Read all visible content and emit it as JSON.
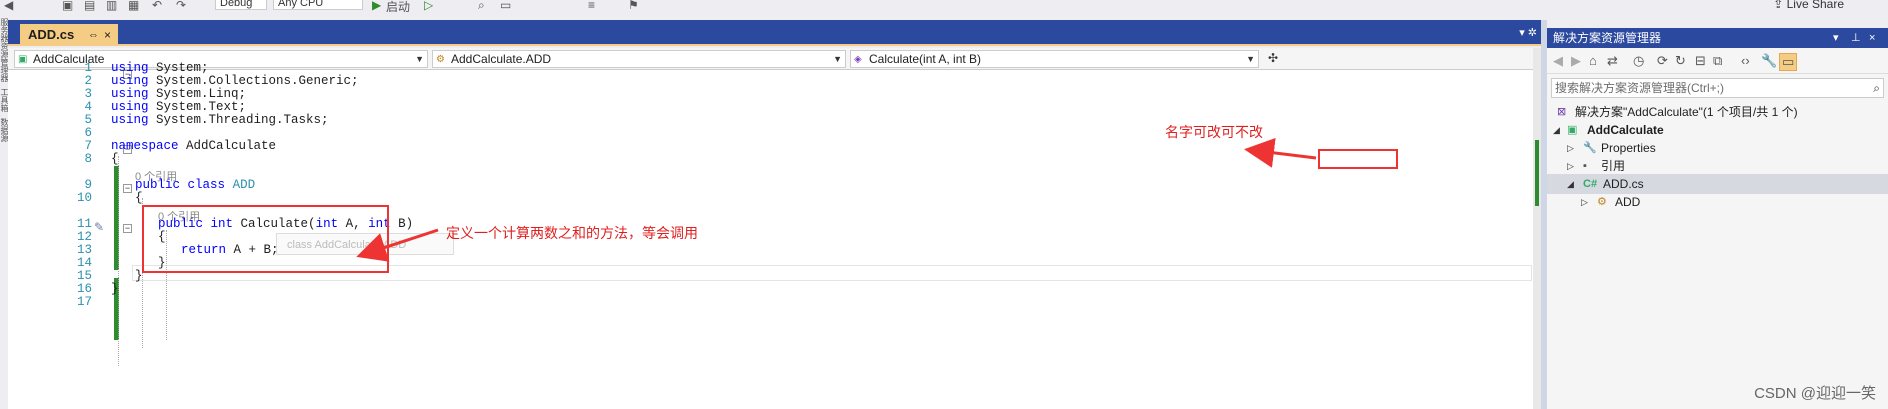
{
  "toolbar": {
    "config_combo": "Debug",
    "platform_combo": "Any CPU",
    "start_label": "启动",
    "live_share": "Live Share"
  },
  "left_bar": {
    "labels": [
      "服务器资源管理器",
      "工具箱",
      "数据源"
    ]
  },
  "editor": {
    "tab": {
      "label": "ADD.cs",
      "pin": "⇔",
      "close": "×"
    },
    "nav": {
      "project": "AddCalculate",
      "type": "AddCalculate.ADD",
      "member": "Calculate(int A, int B)"
    },
    "lines": [
      {
        "n": "1",
        "tokens": [
          {
            "k": "kw",
            "t": "using"
          },
          {
            "k": "",
            "t": " System;"
          }
        ]
      },
      {
        "n": "2",
        "tokens": [
          {
            "k": "kw",
            "t": "using"
          },
          {
            "k": "",
            "t": " System.Collections.Generic;"
          }
        ]
      },
      {
        "n": "3",
        "tokens": [
          {
            "k": "kw",
            "t": "using"
          },
          {
            "k": "",
            "t": " System.Linq;"
          }
        ]
      },
      {
        "n": "4",
        "tokens": [
          {
            "k": "kw",
            "t": "using"
          },
          {
            "k": "",
            "t": " System.Text;"
          }
        ]
      },
      {
        "n": "5",
        "tokens": [
          {
            "k": "kw",
            "t": "using"
          },
          {
            "k": "",
            "t": " System.Threading.Tasks;"
          }
        ]
      },
      {
        "n": "6",
        "tokens": []
      },
      {
        "n": "7",
        "tokens": [
          {
            "k": "kw",
            "t": "namespace"
          },
          {
            "k": "",
            "t": " AddCalculate"
          }
        ]
      },
      {
        "n": "8",
        "tokens": [
          {
            "k": "",
            "t": "{"
          }
        ]
      },
      {
        "n": "9",
        "tokens": [
          {
            "k": "kw",
            "t": "public"
          },
          {
            "k": "",
            "t": " "
          },
          {
            "k": "kw",
            "t": "class"
          },
          {
            "k": "",
            "t": " "
          },
          {
            "k": "ty",
            "t": "ADD"
          }
        ]
      },
      {
        "n": "10",
        "tokens": [
          {
            "k": "",
            "t": "{"
          }
        ]
      },
      {
        "n": "11",
        "tokens": [
          {
            "k": "kw",
            "t": "public"
          },
          {
            "k": "",
            "t": " "
          },
          {
            "k": "kw",
            "t": "int"
          },
          {
            "k": "",
            "t": " Calculate("
          },
          {
            "k": "kw",
            "t": "int"
          },
          {
            "k": "",
            "t": " A, "
          },
          {
            "k": "kw",
            "t": "int"
          },
          {
            "k": "",
            "t": " B)"
          }
        ]
      },
      {
        "n": "12",
        "tokens": [
          {
            "k": "",
            "t": "{"
          }
        ]
      },
      {
        "n": "13",
        "tokens": [
          {
            "k": "kw",
            "t": "return"
          },
          {
            "k": "",
            "t": " A + B;"
          }
        ]
      },
      {
        "n": "14",
        "tokens": [
          {
            "k": "",
            "t": "}"
          }
        ]
      },
      {
        "n": "15",
        "tokens": [
          {
            "k": "",
            "t": "}"
          }
        ]
      },
      {
        "n": "16",
        "tokens": [
          {
            "k": "",
            "t": "}"
          }
        ]
      },
      {
        "n": "17",
        "tokens": []
      }
    ],
    "ref_lens_class": "0 个引用",
    "ref_lens_method": "0 个引用",
    "peek_hint": "class AddCalculate.ADD"
  },
  "solution_explorer": {
    "title": "解决方案资源管理器",
    "search_placeholder": "搜索解决方案资源管理器(Ctrl+;)",
    "items": [
      {
        "label": "解决方案\"AddCalculate\"(1 个项目/共 1 个)",
        "icon": "solution-icon",
        "bold": false
      },
      {
        "label": "AddCalculate",
        "icon": "csharp-project-icon",
        "bold": true
      },
      {
        "label": "Properties",
        "icon": "wrench-icon",
        "bold": false
      },
      {
        "label": "引用",
        "icon": "references-icon",
        "bold": false
      },
      {
        "label": "ADD.cs",
        "icon": "csharp-file-icon",
        "bold": false,
        "icon_text": "C#"
      },
      {
        "label": "ADD",
        "icon": "class-icon",
        "bold": false
      }
    ]
  },
  "annotations": {
    "rename_note": "名字可改可不改",
    "method_note": "定义一个计算两数之和的方法，等会调用"
  },
  "watermark": "CSDN @迎迎一笑",
  "colors": {
    "tab_active": "#f5cc84",
    "title_bar": "#2b4a9f",
    "keyword": "#0000ff",
    "type": "#2b91af",
    "line_number": "#2b91af",
    "annotation_red": "#ee3333",
    "change_bar": "#2e8b2e"
  }
}
